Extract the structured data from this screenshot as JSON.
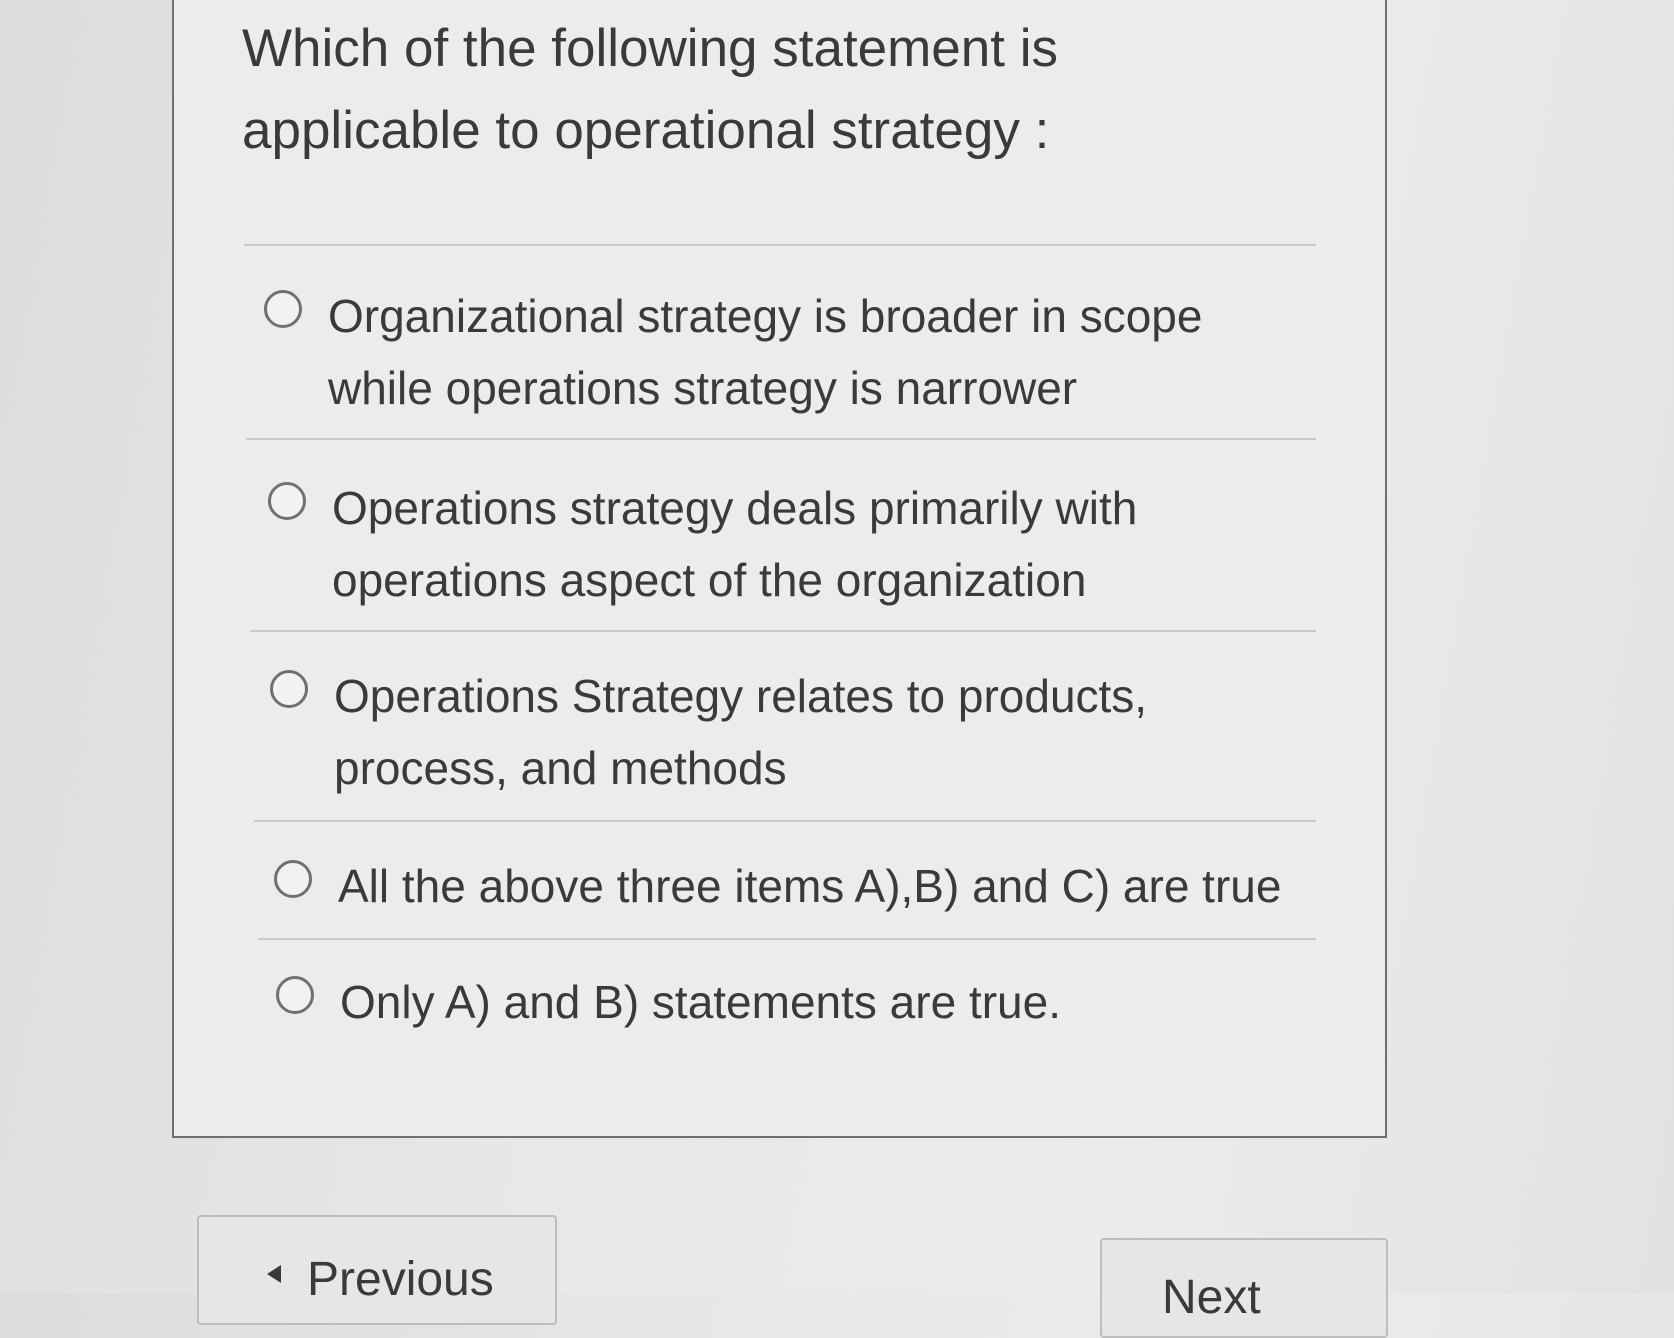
{
  "question": {
    "text": "Which of the following statement is applicable to operational strategy :"
  },
  "options": [
    {
      "label": "Organizational strategy is broader in scope while operations strategy is narrower"
    },
    {
      "label": "Operations strategy deals primarily with operations aspect of the organization"
    },
    {
      "label": "Operations Strategy relates to products, process, and methods"
    },
    {
      "label": "All the above three items A),B) and C) are true"
    },
    {
      "label": "Only A) and B) statements are true."
    }
  ],
  "navigation": {
    "previous_label": "Previous",
    "next_label": "Next"
  }
}
